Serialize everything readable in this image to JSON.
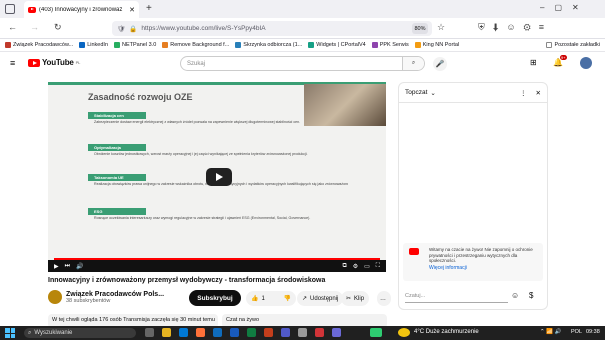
{
  "browser": {
    "tab_title": "(403) Innowacyjny i zrównoważ",
    "url": "https://www.youtube.com/live/S-YsPpy4bIA",
    "zoom": "80%",
    "bookmarks": [
      "Związek Pracodawców...",
      "LinkedIn",
      "NETPanel 3.0",
      "Remove Background f...",
      "Skrzynka odbiorcza (1...",
      "Widgets | CPortalV4",
      "PPK Serwis",
      "King NN Portal"
    ],
    "other_bookmarks": "Pozostałe zakładki"
  },
  "youtube": {
    "logo_text": "YouTube",
    "logo_region": "PL",
    "search_placeholder": "Szukaj",
    "notification_count": "9+"
  },
  "slide": {
    "title": "Zasadność rozwoju OZE",
    "sections": [
      {
        "label": "Stabilizacja cen",
        "text": "Zabezpieczenie dostaw energii elektrycznej z własnych źródeł pozwala na zapewnienie większej długoterminowej stabilności cen."
      },
      {
        "label": "Optymalizacja",
        "text": "Obniżenie kosztów jednostkowych, wzrost marży operacyjnej i jej części wynikającej ze spełnienia kryteriów zrównoważonej produkcji."
      },
      {
        "label": "Taksonomia UE",
        "text": "Realizacja obowiązków prawa unijnego w zakresie wskaźnika obrotu, nakładów inwestycyjnych i wydatków operacyjnych kwalifikujących się jako zrównoważone środowiskowo."
      },
      {
        "label": "ESG",
        "text": "Rosnące oczekiwania interesariuszy oraz wymogi regulacyjne w zakresie strategii i ujawnień ESG (Environmental, Social, Governance)."
      }
    ]
  },
  "video": {
    "title": "Innowacyjny i zrównoważony przemysł wydobywczy - transformacja środowiskowa",
    "channel": "Związek Pracodawców Pols...",
    "subscribers": "38 subskrybentów",
    "subscribe_label": "Subskrybuj",
    "likes": "1",
    "share_label": "Udostępnij",
    "clip_label": "Klip",
    "description_preview": "W tej chwili ogląda 176 osób  Transmisja zaczęła się 30 minut temu",
    "chat_replay_label": "Czat na żywo"
  },
  "chat": {
    "mode": "Topczat",
    "notice_text": "Witamy na czacie na żywo! Nie zapomnij o ochronie prywatności i przestrzeganiu wytycznych dla społeczności.",
    "notice_link": "Więcej informacji",
    "input_placeholder": "Czatuj..."
  },
  "taskbar": {
    "search_placeholder": "Wyszukiwanie",
    "weather": "4°C  Duże zachmurzenie",
    "lang": "POL",
    "time": "09:38"
  }
}
